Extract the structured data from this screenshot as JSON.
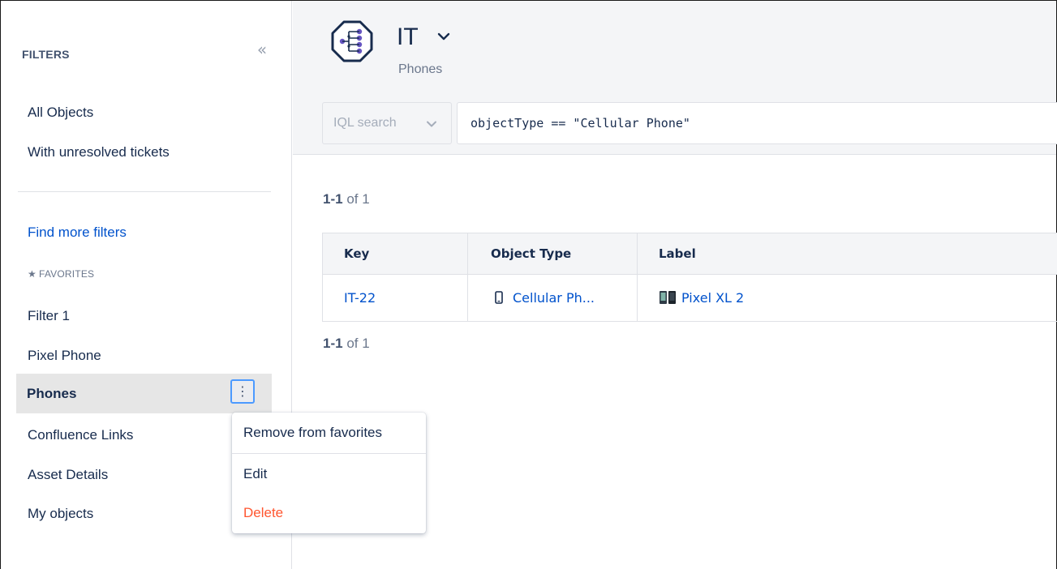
{
  "sidebar": {
    "title": "FILTERS",
    "collapse_glyph": "«",
    "items": [
      {
        "label": "All Objects"
      },
      {
        "label": "With unresolved tickets"
      }
    ],
    "find_more": "Find more filters",
    "favorites_heading": "FAVORITES",
    "favorites": [
      {
        "label": "Filter 1"
      },
      {
        "label": "Pixel Phone"
      },
      {
        "label": "Phones",
        "active": true
      },
      {
        "label": "Confluence Links"
      },
      {
        "label": "Asset Details"
      },
      {
        "label": "My objects"
      }
    ],
    "kebab_glyph": "⋮"
  },
  "context_menu": {
    "items": [
      {
        "label": "Remove from favorites"
      },
      {
        "label": "Edit"
      },
      {
        "label": "Delete",
        "danger": true
      }
    ]
  },
  "header": {
    "schema_name": "IT",
    "schema_subtitle": "Phones",
    "iql_mode": "IQL search",
    "iql_query": "objectType == \"Cellular Phone\""
  },
  "results": {
    "count_top_range": "1-1",
    "count_top_total": "of 1",
    "count_bottom_range": "1-1",
    "count_bottom_total": "of 1",
    "columns": [
      "Key",
      "Object Type",
      "Label"
    ],
    "rows": [
      {
        "key": "IT-22",
        "object_type": "Cellular Ph...",
        "label": "Pixel XL 2"
      }
    ]
  },
  "colors": {
    "accent": "#0052cc",
    "danger": "#ff5630",
    "focus_ring": "#4c9aff",
    "icon_purple": "#6554c0"
  },
  "icons": {
    "schema": "schema-tree-icon",
    "chevron": "chevron-down-icon",
    "star": "star-icon",
    "phone": "mobile-phone-icon",
    "collapse": "double-chevron-left-icon",
    "more": "more-vertical-icon"
  }
}
